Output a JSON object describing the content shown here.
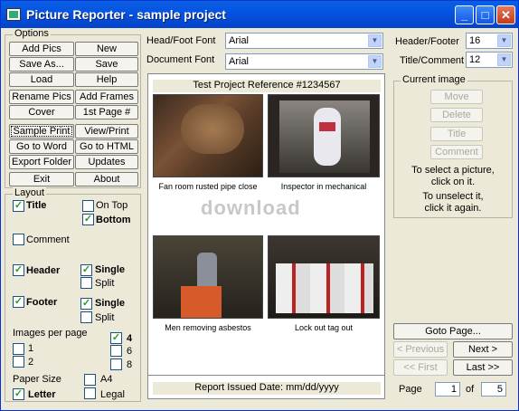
{
  "window": {
    "title": "Picture Reporter - sample project"
  },
  "options": {
    "label": "Options",
    "buttons": [
      "Add Pics",
      "New",
      "Save As...",
      "Save",
      "Load",
      "Help",
      "Rename Pics",
      "Add Frames",
      "Cover",
      "1st Page #",
      "Sample Print",
      "View/Print",
      "Go to Word",
      "Go to HTML",
      "Export Folder",
      "Updates",
      "Exit",
      "About"
    ]
  },
  "layout": {
    "label": "Layout",
    "title": "Title",
    "ontop": "On Top",
    "bottom": "Bottom",
    "comment": "Comment",
    "header": "Header",
    "single1": "Single",
    "split1": "Split",
    "footer": "Footer",
    "single2": "Single",
    "split2": "Split",
    "images_per_page": "Images per page",
    "ipp": [
      "1",
      "2",
      "4",
      "6",
      "8"
    ],
    "paper_size": "Paper Size",
    "letter": "Letter",
    "a4": "A4",
    "legal": "Legal",
    "check_mark": "✓"
  },
  "fonts": {
    "headfoot_label": "Head/Foot Font",
    "headfoot_value": "Arial",
    "document_label": "Document Font",
    "document_value": "Arial",
    "headerfooter_size_label": "Header/Footer",
    "headerfooter_size": "16",
    "titlecomment_size_label": "Title/Comment",
    "titlecomment_size": "12"
  },
  "document": {
    "header_text": "Test Project Reference #1234567",
    "footer_text": "Report Issued Date: mm/dd/yyyy",
    "watermark": "download",
    "captions": [
      "Fan room rusted pipe close",
      "Inspector in mechanical",
      "Men removing asbestos",
      "Lock out tag out"
    ]
  },
  "current_image": {
    "label": "Current image",
    "buttons": [
      "Move",
      "Delete",
      "Title",
      "Comment"
    ],
    "hint1": "To select a picture,",
    "hint2": "click on it.",
    "hint3": "To unselect it,",
    "hint4": "click it again."
  },
  "paging": {
    "goto": "Goto Page...",
    "previous": "< Previous",
    "next": "Next >",
    "first": "<< First",
    "last": "Last >>",
    "page_label": "Page",
    "of_label": "of",
    "current": "1",
    "total": "5"
  }
}
